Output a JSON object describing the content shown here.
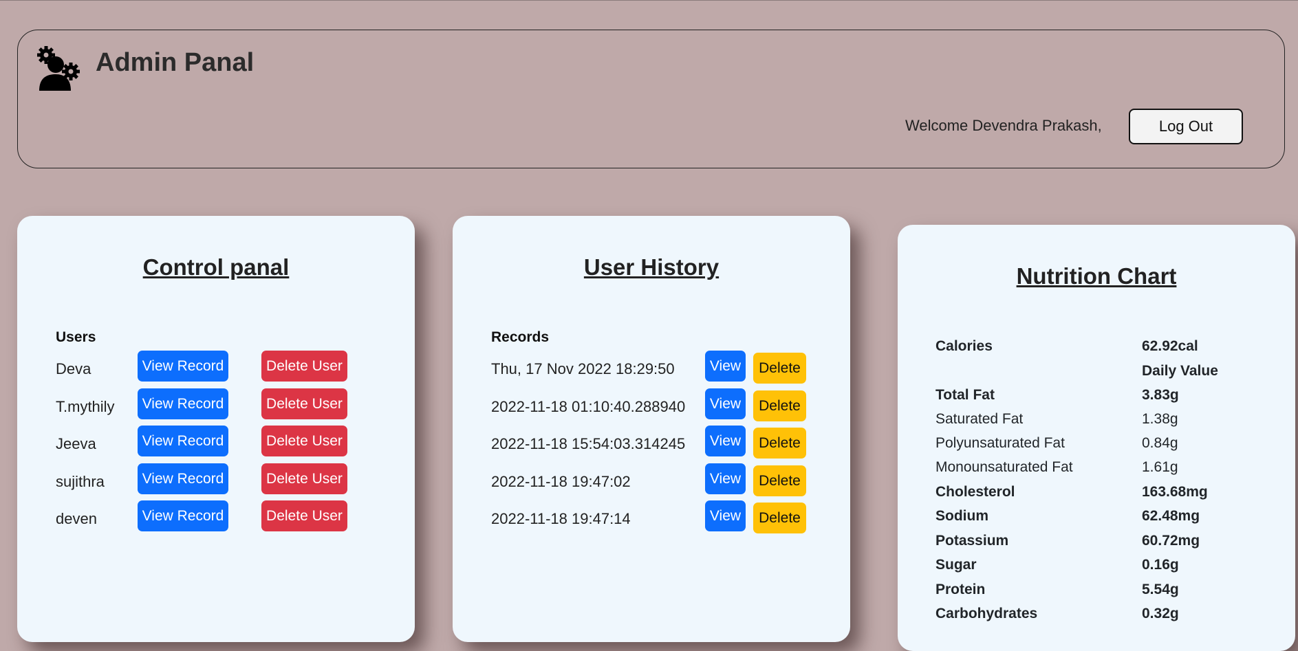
{
  "header": {
    "title": "Admin Panal",
    "welcome": "Welcome Devendra Prakash,",
    "logout_label": "Log Out"
  },
  "control": {
    "title": "Control panal",
    "users_label": "Users",
    "view_label": "View Record",
    "delete_label": "Delete User",
    "users": [
      {
        "name": "Deva"
      },
      {
        "name": "T.mythily"
      },
      {
        "name": "Jeeva"
      },
      {
        "name": "sujithra"
      },
      {
        "name": "deven"
      }
    ]
  },
  "history": {
    "title": "User History",
    "records_label": "Records",
    "view_label": "View",
    "delete_label": "Delete",
    "records": [
      {
        "date": "Thu, 17 Nov 2022 18:29:50"
      },
      {
        "date": "2022-11-18 01:10:40.288940"
      },
      {
        "date": "2022-11-18 15:54:03.314245"
      },
      {
        "date": "2022-11-18 19:47:02"
      },
      {
        "date": "2022-11-18 19:47:14"
      }
    ]
  },
  "nutrition": {
    "title": "Nutrition Chart",
    "rows": [
      {
        "label": "Calories",
        "value": "62.92cal",
        "bold": true
      },
      {
        "label": "",
        "value": "Daily Value",
        "bold": true
      },
      {
        "label": "Total Fat",
        "value": "3.83g",
        "bold": true
      },
      {
        "label": "Saturated Fat",
        "value": "1.38g",
        "bold": false
      },
      {
        "label": "Polyunsaturated Fat",
        "value": "0.84g",
        "bold": false
      },
      {
        "label": "Monounsaturated Fat",
        "value": "1.61g",
        "bold": false
      },
      {
        "label": "Cholesterol",
        "value": "163.68mg",
        "bold": true
      },
      {
        "label": "Sodium",
        "value": "62.48mg",
        "bold": true
      },
      {
        "label": "Potassium",
        "value": "60.72mg",
        "bold": true
      },
      {
        "label": "Sugar",
        "value": "0.16g",
        "bold": true
      },
      {
        "label": "Protein",
        "value": "5.54g",
        "bold": true
      },
      {
        "label": "Carbohydrates",
        "value": "0.32g",
        "bold": true
      }
    ]
  },
  "colors": {
    "background": "#bfa9a9",
    "card": "#eff7fd",
    "primary": "#0d6efd",
    "danger": "#dc3545",
    "warning": "#ffc107"
  },
  "icons": {
    "admin": "admin-gear-user-icon"
  }
}
